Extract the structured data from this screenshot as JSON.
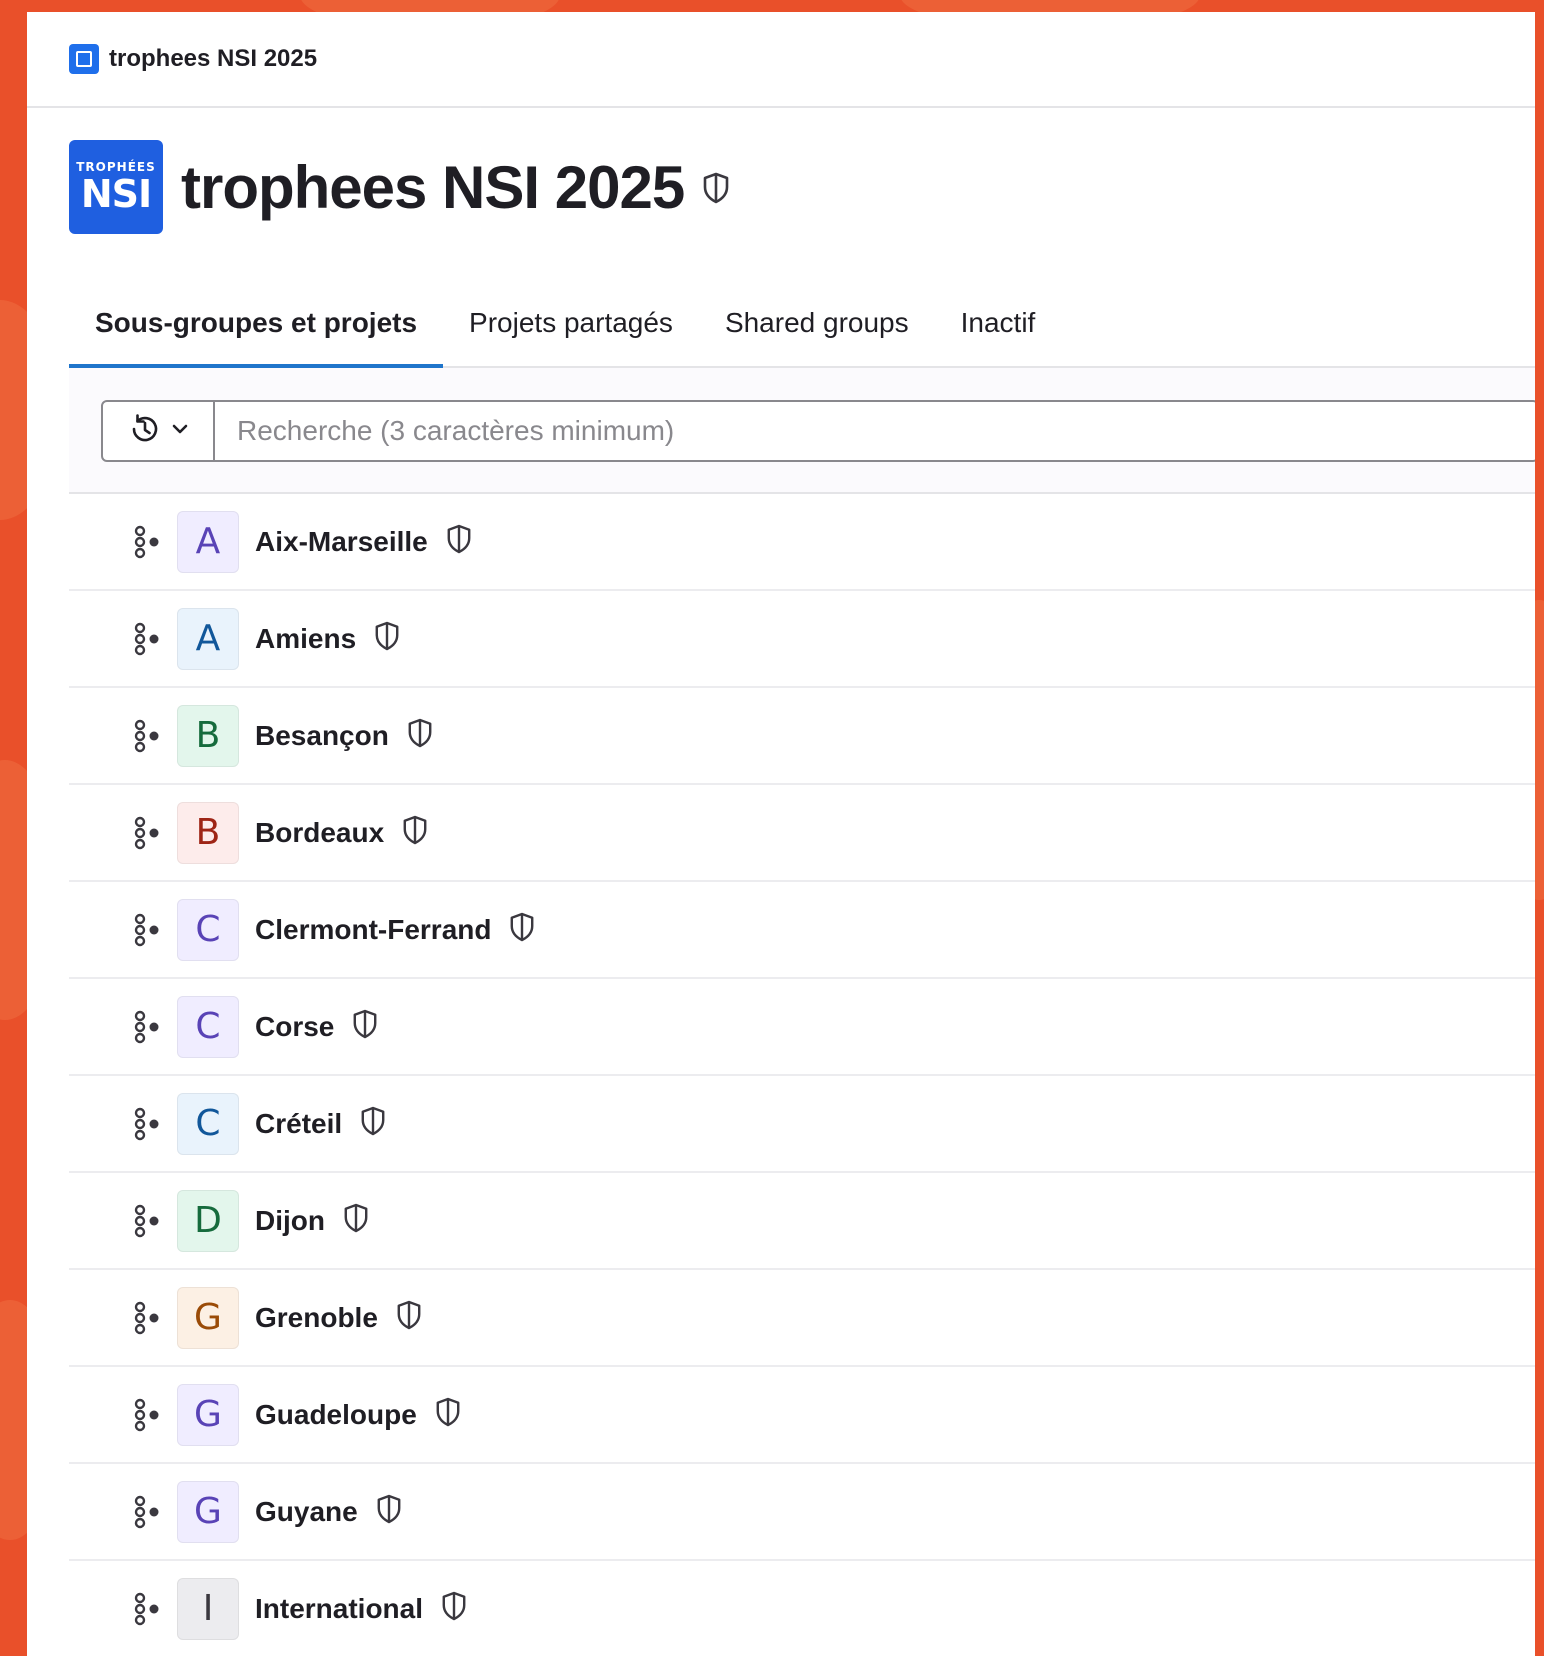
{
  "app": {
    "breadcrumb": "trophees NSI 2025",
    "logo": {
      "line1": "TROPHÉES",
      "line2": "NSI"
    }
  },
  "header": {
    "title": "trophees NSI 2025"
  },
  "tabs": [
    {
      "label": "Sous-groupes et projets",
      "active": true
    },
    {
      "label": "Projets partagés",
      "active": false
    },
    {
      "label": "Shared groups",
      "active": false
    },
    {
      "label": "Inactif",
      "active": false
    }
  ],
  "search": {
    "placeholder": "Recherche (3 caractères minimum)",
    "value": ""
  },
  "groups": [
    {
      "letter": "A",
      "name": "Aix-Marseille",
      "bg": "#f0edff",
      "fg": "#5943b6"
    },
    {
      "letter": "A",
      "name": "Amiens",
      "bg": "#e9f3fc",
      "fg": "#11579a"
    },
    {
      "letter": "B",
      "name": "Besançon",
      "bg": "#e3f6ec",
      "fg": "#166b3d"
    },
    {
      "letter": "B",
      "name": "Bordeaux",
      "bg": "#fdeceb",
      "fg": "#9e2516"
    },
    {
      "letter": "C",
      "name": "Clermont-Ferrand",
      "bg": "#f0edff",
      "fg": "#5943b6"
    },
    {
      "letter": "C",
      "name": "Corse",
      "bg": "#f0edff",
      "fg": "#5943b6"
    },
    {
      "letter": "C",
      "name": "Créteil",
      "bg": "#e9f3fc",
      "fg": "#11579a"
    },
    {
      "letter": "D",
      "name": "Dijon",
      "bg": "#e3f6ec",
      "fg": "#166b3d"
    },
    {
      "letter": "G",
      "name": "Grenoble",
      "bg": "#fcf0e4",
      "fg": "#9a4b07"
    },
    {
      "letter": "G",
      "name": "Guadeloupe",
      "bg": "#f0edff",
      "fg": "#5943b6"
    },
    {
      "letter": "G",
      "name": "Guyane",
      "bg": "#f0edff",
      "fg": "#5943b6"
    },
    {
      "letter": "I",
      "name": "International",
      "bg": "#ececef",
      "fg": "#3a383f"
    }
  ],
  "colors": {
    "accent": "#1f75cb",
    "brand": "#1f5fe0",
    "backdrop": "#e9502a"
  }
}
